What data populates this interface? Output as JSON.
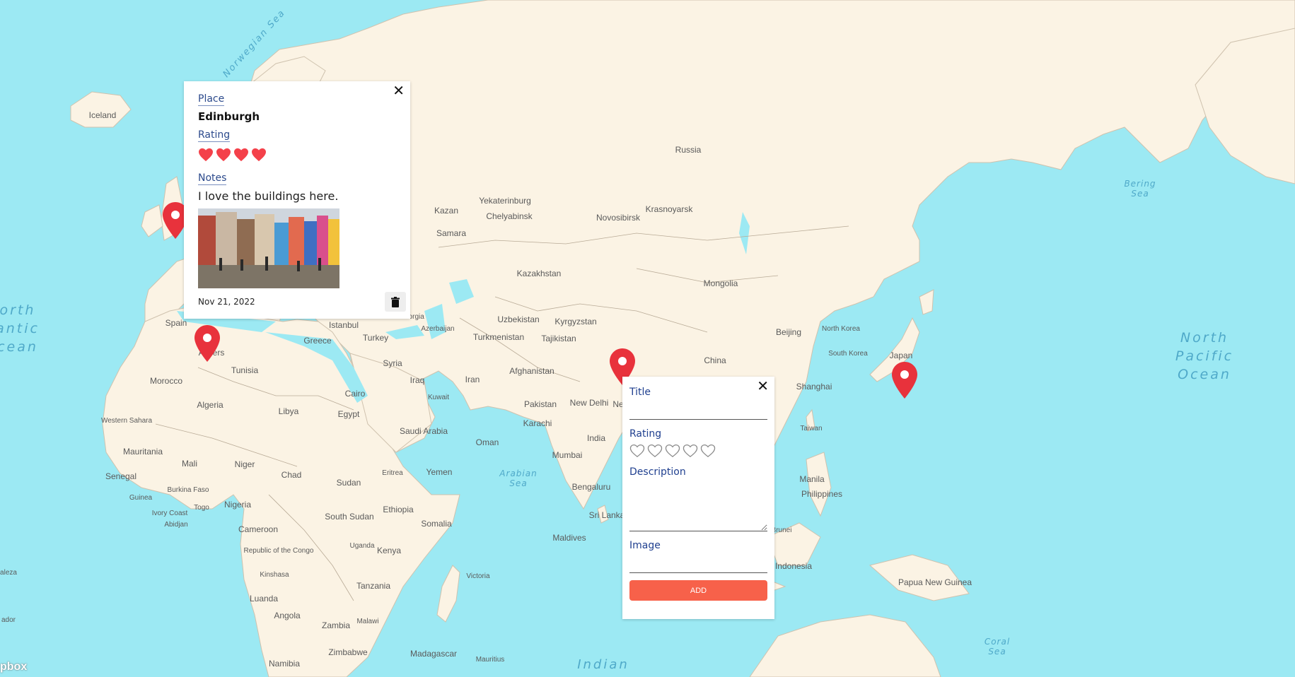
{
  "map": {
    "attribution": "pbox",
    "colors": {
      "water": "#9ce9f3",
      "land": "#fbf3e4",
      "border": "#b8aa96",
      "marker": "#e8323c",
      "accent_button": "#f7614a",
      "label_blue": "#2c4a8c"
    },
    "oceans": [
      {
        "name": "Norwegian Sea",
        "line1": "Norwegian Sea"
      },
      {
        "name": "North Atlantic Ocean",
        "line1": "orth",
        "line2": "antic",
        "line3": "cean"
      },
      {
        "name": "North Pacific Ocean",
        "line1": "North",
        "line2": "Pacific",
        "line3": "Ocean"
      },
      {
        "name": "Bering Sea",
        "line1": "Bering",
        "line2": "Sea"
      },
      {
        "name": "Arabian Sea",
        "line1": "Arabian",
        "line2": "Sea"
      },
      {
        "name": "Coral Sea",
        "line1": "Coral",
        "line2": "Sea"
      },
      {
        "name": "Indian",
        "line1": "Indian"
      }
    ],
    "labels": [
      "Iceland",
      "Russia",
      "Yekaterinburg",
      "Kazan",
      "Chelyabinsk",
      "Novosibirsk",
      "Krasnoyarsk",
      "Samara",
      "Kazakhstan",
      "Mongolia",
      "Uzbekistan",
      "Kyrgyzstan",
      "Turkmenistan",
      "Tajikistan",
      "Beijing",
      "North Korea",
      "South Korea",
      "Japan",
      "China",
      "Shanghai",
      "Taiwan",
      "Afghanistan",
      "Pakistan",
      "New Delhi",
      "Karachi",
      "India",
      "Mumbai",
      "Bengaluru",
      "Sri Lanka",
      "Maldives",
      "Iran",
      "Iraq",
      "Kuwait",
      "Syria",
      "Turkey",
      "Greece",
      "Istanbul",
      "Georgia",
      "Azerbaijan",
      "Spain",
      "Algiers",
      "Tunisia",
      "Morocco",
      "Algeria",
      "Libya",
      "Egypt",
      "Cairo",
      "Saudi Arabia",
      "Oman",
      "Yemen",
      "Eritrea",
      "Ethiopia",
      "Somalia",
      "Sudan",
      "South Sudan",
      "Chad",
      "Niger",
      "Mali",
      "Mauritania",
      "Western Sahara",
      "Senegal",
      "Guinea",
      "Burkina Faso",
      "Nigeria",
      "Ivory Coast",
      "Abidjan",
      "Togo",
      "Cameroon",
      "Republic of the Congo",
      "Kinshasa",
      "Luanda",
      "Angola",
      "Zambia",
      "Malawi",
      "Zimbabwe",
      "Namibia",
      "Madagascar",
      "Mauritius",
      "Uganda",
      "Kenya",
      "Tanzania",
      "Victoria",
      "Manila",
      "Philippines",
      "Brunei",
      "Indonesia",
      "Papua New Guinea",
      "Ne",
      "aleza",
      "ador"
    ]
  },
  "place_popup": {
    "place_label": "Place",
    "place_value": "Edinburgh",
    "rating_label": "Rating",
    "rating": 4,
    "rating_max": 4,
    "notes_label": "Notes",
    "notes_value": "I love the buildings here.",
    "image_alt": "Colourful buildings on a street in Edinburgh",
    "date": "Nov 21, 2022",
    "close_glyph": "✕"
  },
  "add_form": {
    "title_label": "Title",
    "title_value": "",
    "rating_label": "Rating",
    "rating": 0,
    "rating_max": 5,
    "description_label": "Description",
    "description_value": "",
    "image_label": "Image",
    "image_value": "",
    "add_button": "ADD",
    "close_glyph": "✕"
  }
}
